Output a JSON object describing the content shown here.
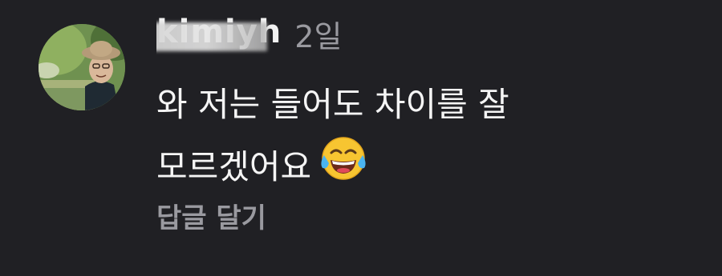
{
  "comment": {
    "username": "kimiyh",
    "time": "2일",
    "text_line1": "와 저는 들어도 차이를 잘",
    "text_line2": "모르겠어요",
    "emoji": "face-with-tears-of-joy-icon",
    "reply_label": "답글 달기"
  },
  "colors": {
    "background": "#202024",
    "text_primary": "#f5f5f5",
    "text_secondary": "#9a9aa0"
  }
}
